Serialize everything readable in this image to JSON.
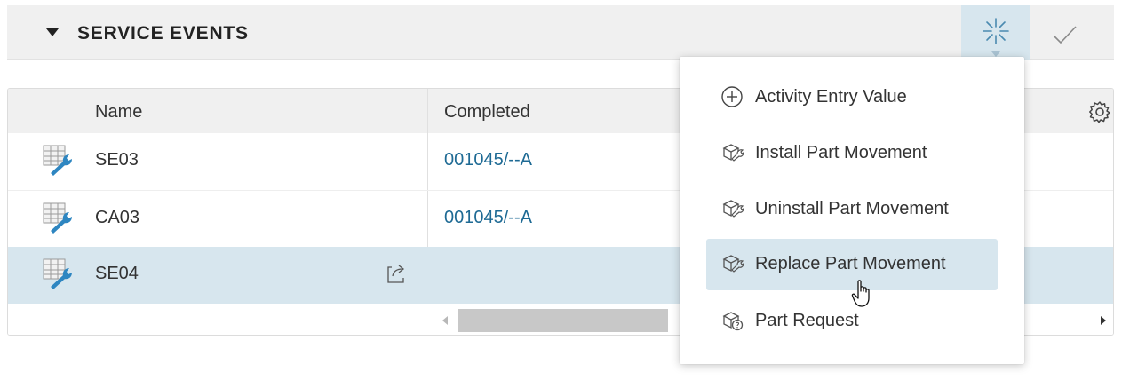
{
  "section": {
    "title": "SERVICE EVENTS"
  },
  "grid": {
    "columns": [
      "Name",
      "Completed"
    ],
    "rows": [
      {
        "name": "SE03",
        "completed": "001045/--A",
        "selected": false
      },
      {
        "name": "CA03",
        "completed": "001045/--A",
        "selected": false
      },
      {
        "name": "SE04",
        "completed": "",
        "selected": true
      }
    ]
  },
  "menu": {
    "items": [
      {
        "label": "Activity Entry Value",
        "icon": "plus-circle-icon"
      },
      {
        "label": "Install Part Movement",
        "icon": "part-movement-icon"
      },
      {
        "label": "Uninstall Part Movement",
        "icon": "part-movement-icon"
      },
      {
        "label": "Replace Part Movement",
        "icon": "part-movement-icon"
      },
      {
        "label": "Part Request",
        "icon": "part-request-icon"
      }
    ],
    "hovered_index": 3
  },
  "colors": {
    "accent_bg": "#d7e6ee",
    "link": "#1e6a94",
    "header_bg": "#f0f0f0"
  }
}
